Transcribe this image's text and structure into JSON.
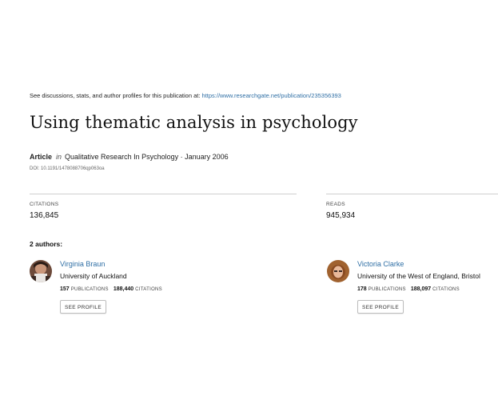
{
  "header": {
    "intro": "See discussions, stats, and author profiles for this publication at:",
    "url": "https://www.researchgate.net/publication/235356393"
  },
  "publication": {
    "title": "Using thematic analysis in psychology",
    "type": "Article",
    "in_word": "in",
    "journal": "Qualitative Research In Psychology · January 2006",
    "doi": "DOI: 10.1191/1478088706qp063oa"
  },
  "stats": {
    "citations_label": "CITATIONS",
    "citations_value": "136,845",
    "reads_label": "READS",
    "reads_value": "945,934"
  },
  "authors_heading": "2 authors:",
  "authors": [
    {
      "name": "Virginia Braun",
      "institution": "University of Auckland",
      "publications": "157",
      "publications_label": "PUBLICATIONS",
      "citations": "188,440",
      "citations_label": "CITATIONS",
      "button": "SEE PROFILE"
    },
    {
      "name": "Victoria Clarke",
      "institution": "University of the West of England, Bristol",
      "publications": "178",
      "publications_label": "PUBLICATIONS",
      "citations": "188,097",
      "citations_label": "CITATIONS",
      "button": "SEE PROFILE"
    }
  ],
  "colors": {
    "link": "#2f6fa5",
    "rule": "#cfcfcf"
  }
}
